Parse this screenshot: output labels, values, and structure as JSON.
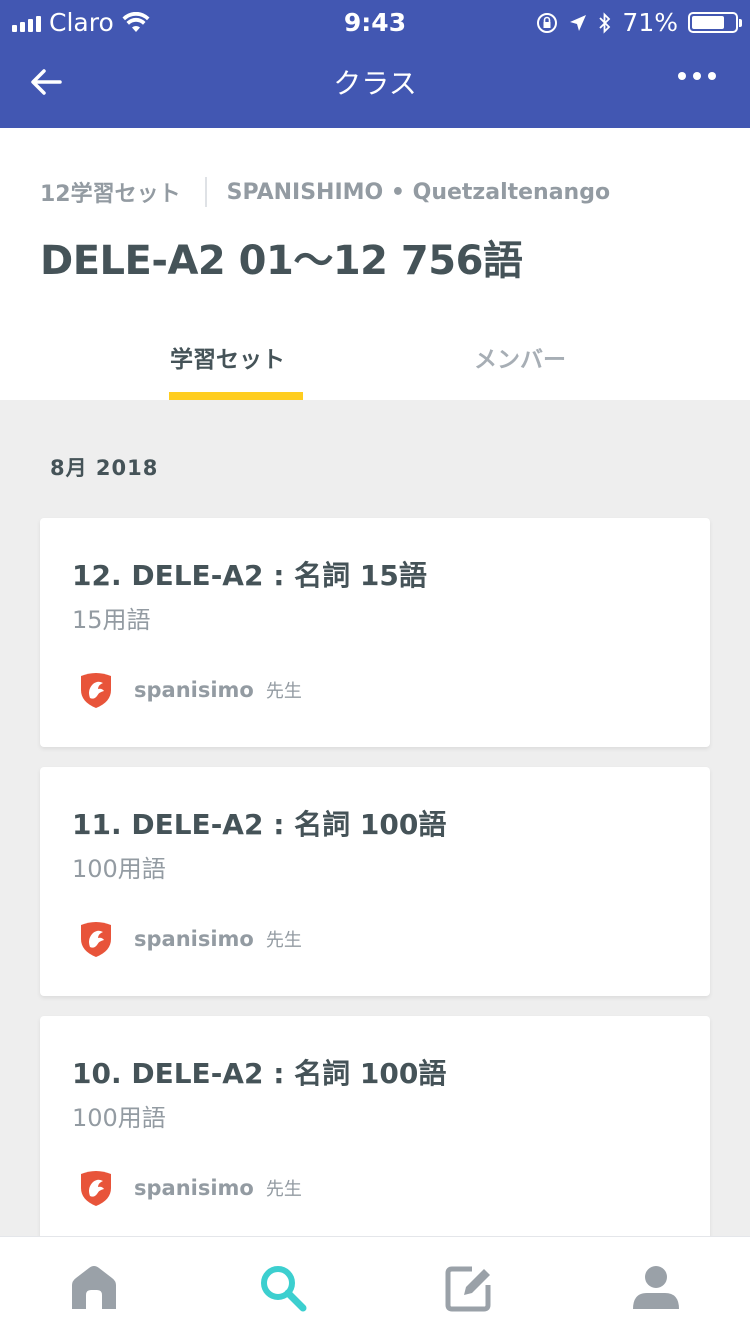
{
  "status_bar": {
    "carrier": "Claro",
    "time": "9:43",
    "battery": "71%"
  },
  "nav": {
    "title": "クラス"
  },
  "class": {
    "set_count": "12学習セット",
    "school": "SPANISHIMO • Quetzaltenango",
    "title": "DELE-A2 01〜12 756語"
  },
  "tabs": [
    {
      "label": "学習セット",
      "active": true
    },
    {
      "label": "メンバー",
      "active": false
    }
  ],
  "section": {
    "month": "8月 2018"
  },
  "sets": [
    {
      "title": "12. DELE-A2 : 名詞 15語",
      "terms": "15用語",
      "author": "spanisimo",
      "role": "先生"
    },
    {
      "title": "11. DELE-A2 : 名詞 100語",
      "terms": "100用語",
      "author": "spanisimo",
      "role": "先生"
    },
    {
      "title": "10. DELE-A2 : 名詞 100語",
      "terms": "100用語",
      "author": "spanisimo",
      "role": "先生"
    }
  ],
  "bottom_nav": [
    "home-icon",
    "search-icon",
    "create-icon",
    "profile-icon"
  ],
  "colors": {
    "nav_blue": "#4257b2",
    "accent_yellow": "#ffcd1f",
    "search_teal": "#3ccfcf"
  }
}
